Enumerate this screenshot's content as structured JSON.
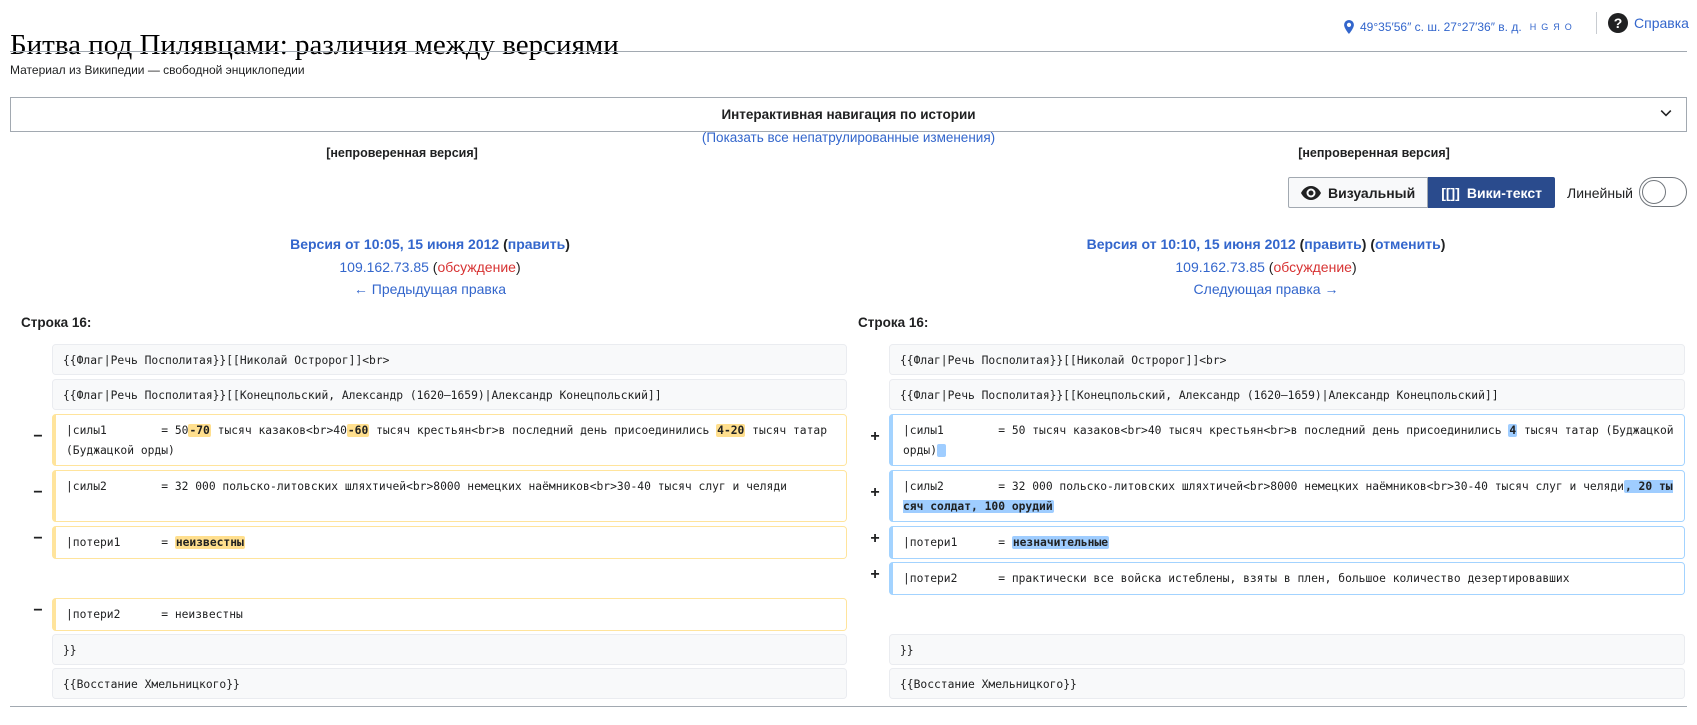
{
  "page": {
    "title": "Битва под Пилявцами: различия между версиями",
    "tagline": "Материал из Википедии — свободной энциклопедии",
    "coords": "49°35′56″ с. ш. 27°27′36″ в. д.",
    "coords_letters": "HGЯO",
    "help_label": "Справка"
  },
  "nav": {
    "history_nav_label": "Интерактивная навигация по истории",
    "unpatrolled_link": "(Показать все непатрулированные изменения)"
  },
  "left": {
    "unverified": "[непроверенная версия]",
    "rev_title": "Версия от 10:05, 15 июня 2012",
    "rev_paren_open": " (",
    "edit_link": "править",
    "rev_paren_close": ")",
    "user": "109.162.73.85",
    "talk_link": "обсуждение",
    "nav_link": "← Предыдущая правка",
    "line_label": "Строка 16:"
  },
  "right": {
    "unverified": "[непроверенная версия]",
    "rev_title": "Версия от 10:10, 15 июня 2012",
    "edit_link": "править",
    "undo_link": "отменить",
    "user": "109.162.73.85",
    "talk_link": "обсуждение",
    "nav_link": "Следующая правка →",
    "line_label": "Строка 16:"
  },
  "toolbar": {
    "visual_label": "Визуальный",
    "wikitext_icon": "[[]]",
    "wikitext_label": "Вики-текст",
    "linear_label": "Линейный"
  },
  "diff": {
    "ctx1": "{{Флаг|Речь Посполитая}}[[Николай Остророг]]<br>",
    "ctx2": "{{Флаг|Речь Посполитая}}[[Конецпольский, Александр (1620—1659)|Александр Конецпольский]]",
    "del1": [
      "|силы1        = 50",
      "-70",
      " тысяч казаков<br>40",
      "-60",
      " тысяч крестьян<br>в последний день присоединились ",
      "4-20",
      " тысяч татар (Буджацкой орды)"
    ],
    "add1": [
      "|силы1        = 50 тысяч казаков<br>40 тысяч крестьян<br>в последний день присоединились ",
      "4",
      " тысяч татар (Буджацкой орды)",
      " "
    ],
    "del2": "|силы2        = 32 000 польско-литовских шляхтичей<br>8000 немецких наёмников<br>30-40 тысяч слуг и челяди",
    "add2": [
      "|силы2        = 32 000 польско-литовских шляхтичей<br>8000 немецких наёмников<br>30-40 тысяч слуг и челяди",
      ", 20 тысяч солдат, 100 орудий"
    ],
    "del3": [
      "|потери1      = ",
      "неизвестны"
    ],
    "add3": [
      "|потери1      = ",
      "незначительные"
    ],
    "add4": "|потери2      = практически все войска истеблены, взяты в плен, большое количество дезертировавших",
    "del4": "|потери2      = неизвестны",
    "ctx3": "}}",
    "ctx4": "{{Восстание Хмельницкого}}",
    "minus": "−",
    "plus": "+"
  },
  "colors": {
    "link": "#3366cc",
    "red_link": "#d73333",
    "deleted_border": "#ffe49c",
    "added_border": "#a3d3ff",
    "active_toggle": "#2a4b8d"
  }
}
